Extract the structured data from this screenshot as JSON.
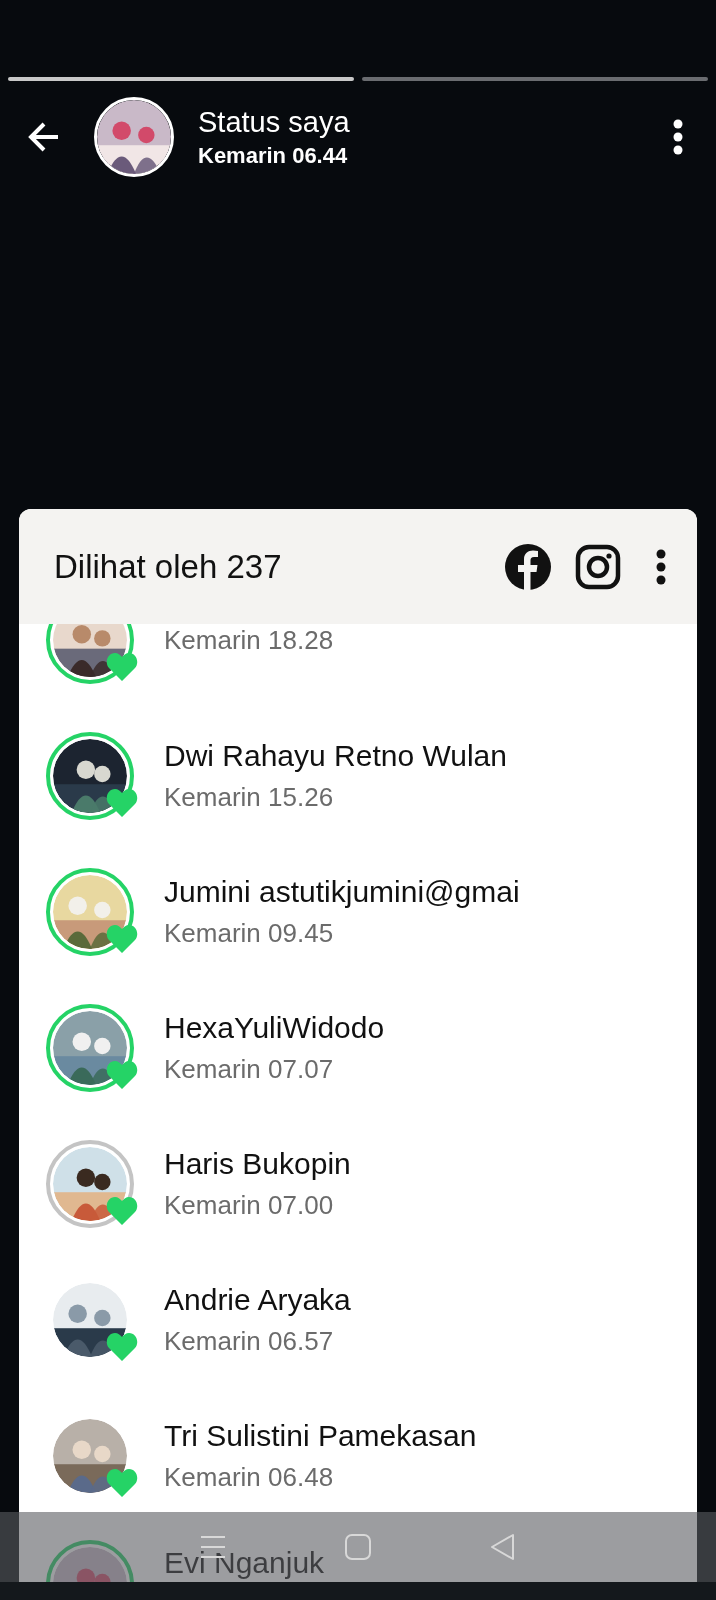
{
  "progress": [
    {
      "viewed": true
    },
    {
      "viewed": false
    }
  ],
  "header": {
    "title": "Status saya",
    "time": "Kemarin 06.44"
  },
  "viewers_sheet": {
    "title": "Dilihat oleh 237",
    "viewers": [
      {
        "time": "Kemarin 18.28",
        "kind": "unseen"
      },
      {
        "name": "Dwi Rahayu Retno Wulan",
        "time": "Kemarin 15.26",
        "kind": "unseen"
      },
      {
        "name": "Jumini astutikjumini@gmai",
        "time": "Kemarin 09.45",
        "kind": "unseen"
      },
      {
        "name": "HexaYuliWidodo",
        "time": "Kemarin 07.07",
        "kind": "unseen"
      },
      {
        "name": "Haris Bukopin",
        "time": "Kemarin 07.00",
        "kind": "seen"
      },
      {
        "name": "Andrie Aryaka",
        "time": "Kemarin 06.57",
        "kind": "plain"
      },
      {
        "name": "Tri Sulistini Pamekasan",
        "time": "Kemarin 06.48",
        "kind": "plain"
      },
      {
        "name": "Evi Nganjuk",
        "kind": "unseen"
      }
    ]
  }
}
